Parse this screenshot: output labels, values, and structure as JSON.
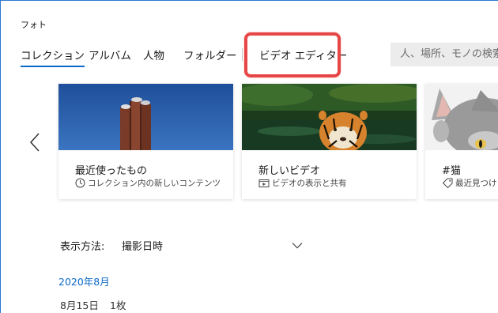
{
  "app": {
    "title": "フォト"
  },
  "nav": {
    "tabs": [
      {
        "label": "コレクション",
        "active": true
      },
      {
        "label": "アルバム",
        "active": false
      },
      {
        "label": "人物",
        "active": false
      },
      {
        "label": "フォルダー",
        "active": false
      },
      {
        "label": "ビデオ エディター",
        "active": false
      }
    ]
  },
  "search": {
    "placeholder": "人、場所、モノの検索..."
  },
  "cards": [
    {
      "title": "最近使ったもの",
      "subtitle": "コレクション内の新しいコンテンツ",
      "icon": "clock-icon"
    },
    {
      "title": "新しいビデオ",
      "subtitle": "ビデオの表示と共有",
      "icon": "video-icon"
    },
    {
      "title": "#猫",
      "subtitle": "最近見つけ",
      "icon": "tag-icon"
    }
  ],
  "sort": {
    "label": "表示方法:",
    "value": "撮影日時"
  },
  "timeline": {
    "month": "2020年8月",
    "day": "8月15日",
    "count": "1枚"
  },
  "colors": {
    "accent": "#0a69c8",
    "highlight": "#e74646"
  }
}
